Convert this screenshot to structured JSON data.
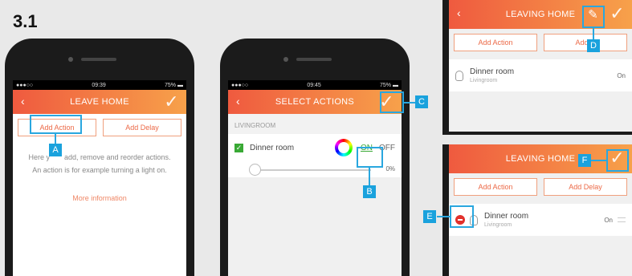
{
  "step_label": "3.1",
  "screen1": {
    "status_time": "09:39",
    "status_battery": "75%",
    "title": "LEAVE HOME",
    "add_action": "Add Action",
    "add_delay": "Add Delay",
    "help_line1": "Here y",
    "help_line1b": "add, remove and reorder actions.",
    "help_line2": "An action is for example turning a light on.",
    "more_info": "More information"
  },
  "screen2": {
    "status_time": "09:45",
    "status_battery": "75%",
    "title": "SELECT ACTIONS",
    "section": "LIVINGROOM",
    "item": "Dinner room",
    "on": "ON",
    "off": "OFF",
    "dim_value": "0%"
  },
  "screen3": {
    "title": "LEAVING HOME",
    "add_action": "Add Action",
    "add_delay": "Add D",
    "item": "Dinner room",
    "item_sub": "Livingroom",
    "state": "On"
  },
  "screen4": {
    "title": "LEAVING HOME",
    "add_action": "Add Action",
    "add_delay": "Add Delay",
    "item": "Dinner room",
    "item_sub": "Livingroom",
    "state": "On"
  },
  "callouts": {
    "a": "A",
    "b": "B",
    "c": "C",
    "d": "D",
    "e": "E",
    "f": "F"
  }
}
